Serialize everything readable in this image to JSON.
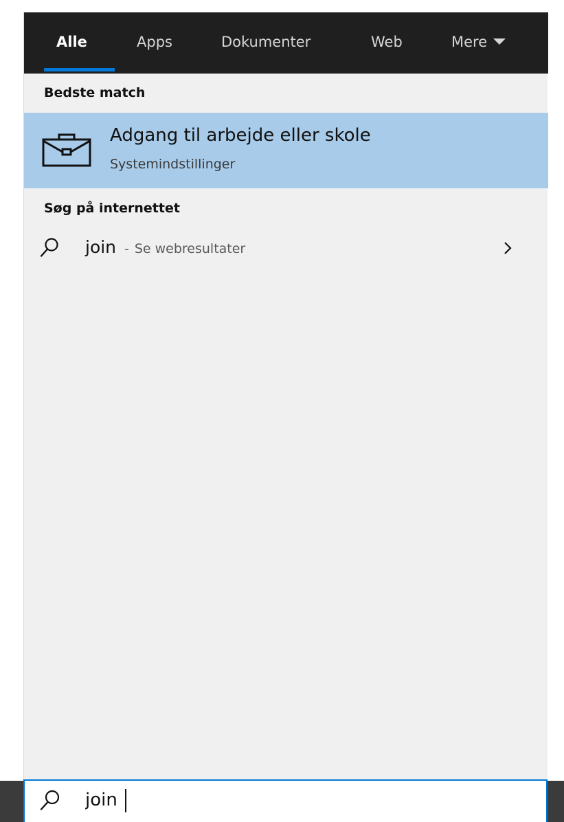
{
  "tabs": [
    {
      "label": "Alle",
      "active": true
    },
    {
      "label": "Apps",
      "active": false
    },
    {
      "label": "Dokumenter",
      "active": false
    },
    {
      "label": "Web",
      "active": false
    },
    {
      "label": "Mere",
      "active": false,
      "icon": "caret-down-icon"
    }
  ],
  "best_match": {
    "heading": "Bedste match",
    "title": "Adgang til arbejde eller skole",
    "subtitle": "Systemindstillinger",
    "icon": "briefcase-icon"
  },
  "web_search": {
    "heading": "Søg på internettet",
    "query": "join",
    "separator": "-",
    "hint": "Se webresultater",
    "icon": "search-icon",
    "action_icon": "chevron-right-icon"
  },
  "search_box": {
    "value": "join",
    "icon": "search-icon"
  },
  "colors": {
    "tabbar_bg": "#1f1f1f",
    "accent": "#0078d7",
    "selection": "#a8cbea",
    "panel_bg": "#f0f0f0",
    "taskbar_bg": "#3b3b3b"
  }
}
